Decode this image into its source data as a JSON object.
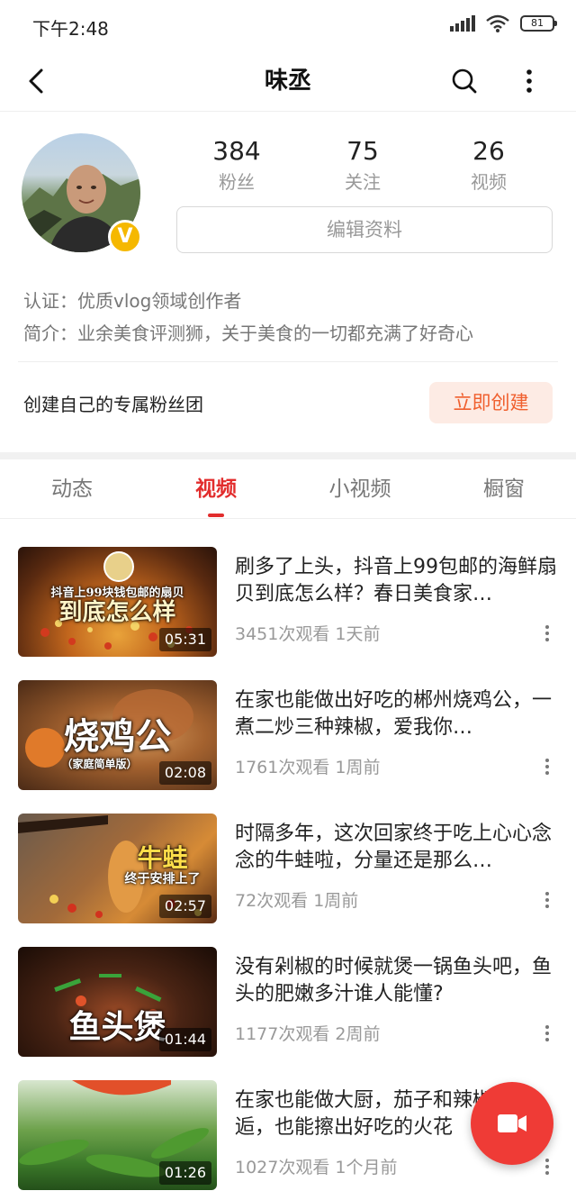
{
  "status_bar": {
    "time": "下午2:48",
    "battery": "81"
  },
  "nav": {
    "title": "味丞"
  },
  "profile": {
    "stats": [
      {
        "num": "384",
        "label": "粉丝"
      },
      {
        "num": "75",
        "label": "关注"
      },
      {
        "num": "26",
        "label": "视频"
      }
    ],
    "edit_label": "编辑资料",
    "verified_badge": "V",
    "certification": "认证：优质vlog领域创作者",
    "bio": "简介：业余美食评测狮，关于美食的一切都充满了好奇心"
  },
  "fan_group": {
    "text": "创建自己的专属粉丝团",
    "button": "立即创建"
  },
  "tabs": [
    {
      "label": "动态",
      "active": false
    },
    {
      "label": "视频",
      "active": true
    },
    {
      "label": "小视频",
      "active": false
    },
    {
      "label": "橱窗",
      "active": false
    }
  ],
  "videos": [
    {
      "title": "刷多了上头，抖音上99包邮的海鲜扇贝到底怎么样？春日美食家…",
      "meta": "3451次观看  1天前",
      "duration": "05:31",
      "thumb_text": "到底怎么样",
      "thumb_subtext": "抖音上99块钱包邮的扇贝"
    },
    {
      "title": "在家也能做出好吃的郴州烧鸡公，一煮二炒三种辣椒，爱我你…",
      "meta": "1761次观看  1周前",
      "duration": "02:08",
      "thumb_text": "烧鸡公",
      "thumb_subtext": "（家庭简单版）"
    },
    {
      "title": "时隔多年，这次回家终于吃上心心念念的牛蛙啦，分量还是那么…",
      "meta": "72次观看  1周前",
      "duration": "02:57",
      "thumb_text": "牛蛙",
      "thumb_subtext": "终于安排上了"
    },
    {
      "title": "没有剁椒的时候就煲一锅鱼头吧，鱼头的肥嫩多汁谁人能懂?",
      "meta": "1177次观看  2周前",
      "duration": "01:44",
      "thumb_text": "鱼头煲",
      "thumb_subtext": ""
    },
    {
      "title": "在家也能做大厨，茄子和辣椒的邂逅，也能擦出好吃的火花",
      "meta": "1027次观看  1个月前",
      "duration": "01:26",
      "thumb_text": "",
      "thumb_subtext": ""
    }
  ]
}
